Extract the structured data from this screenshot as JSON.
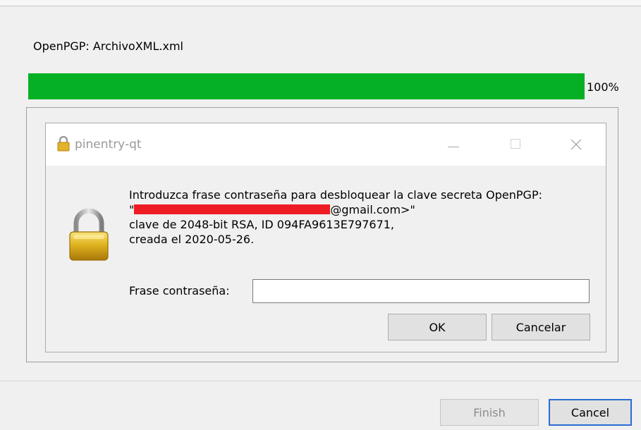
{
  "wizard": {
    "task_title": "OpenPGP: ArchivoXML.xml",
    "progress_fraction": 1.0,
    "progress_label": "100%",
    "finish_label": "Finish",
    "cancel_label": "Cancel"
  },
  "dialog": {
    "title": "pinentry-qt",
    "message": {
      "line1": "Introduzca frase contraseña para desbloquear la clave secreta OpenPGP:",
      "line2_prefix": "\"",
      "line2_suffix": "@gmail.com>\"",
      "line3": "clave de 2048-bit RSA, ID 094FA9613E797671,",
      "line4": "creada el 2020-05-26."
    },
    "passphrase_label": "Frase contraseña:",
    "passphrase_value": "",
    "ok_label": "OK",
    "cancel_label": "Cancelar"
  },
  "colors": {
    "progress_fill": "#06b025",
    "redaction": "#ee1c24",
    "focus_border": "#2b6cd3"
  },
  "icons": [
    "lock-icon",
    "minimize-icon",
    "maximize-icon",
    "close-icon",
    "padlock-icon"
  ]
}
